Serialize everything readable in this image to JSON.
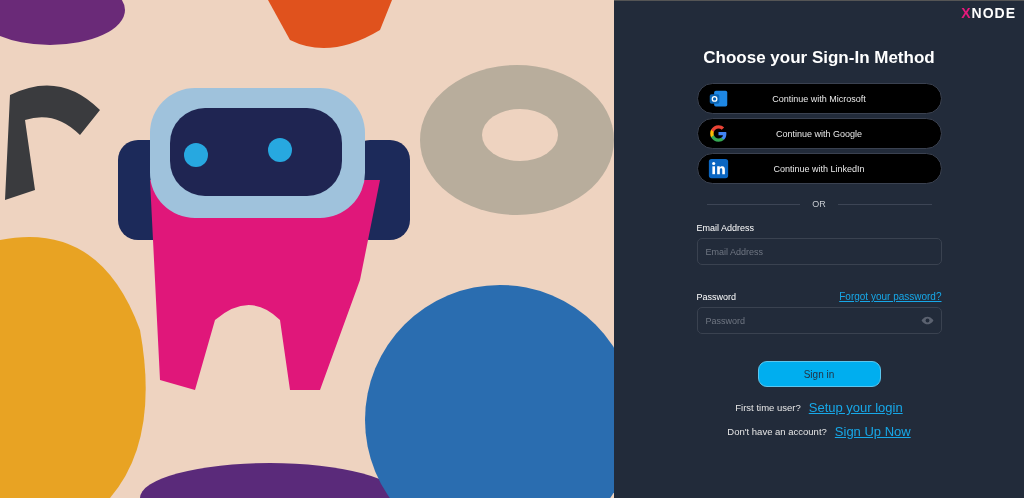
{
  "logo": {
    "mark": "X",
    "text": "NODE"
  },
  "title": "Choose your Sign-In Method",
  "providers": [
    {
      "kind": "microsoft",
      "label": "Continue with Microsoft"
    },
    {
      "kind": "google",
      "label": "Continue with Google"
    },
    {
      "kind": "linkedin",
      "label": "Continue with LinkedIn"
    }
  ],
  "divider": "OR",
  "email": {
    "label": "Email Address",
    "placeholder": "Email Address"
  },
  "password": {
    "label": "Password",
    "placeholder": "Password",
    "forgot_link": "Forgot your password?"
  },
  "sign_in_button": "Sign in",
  "footer_links": [
    {
      "prompt": "First time user?",
      "link": "Setup your login"
    },
    {
      "prompt": "Don't have an account?",
      "link": "Sign Up Now"
    }
  ]
}
